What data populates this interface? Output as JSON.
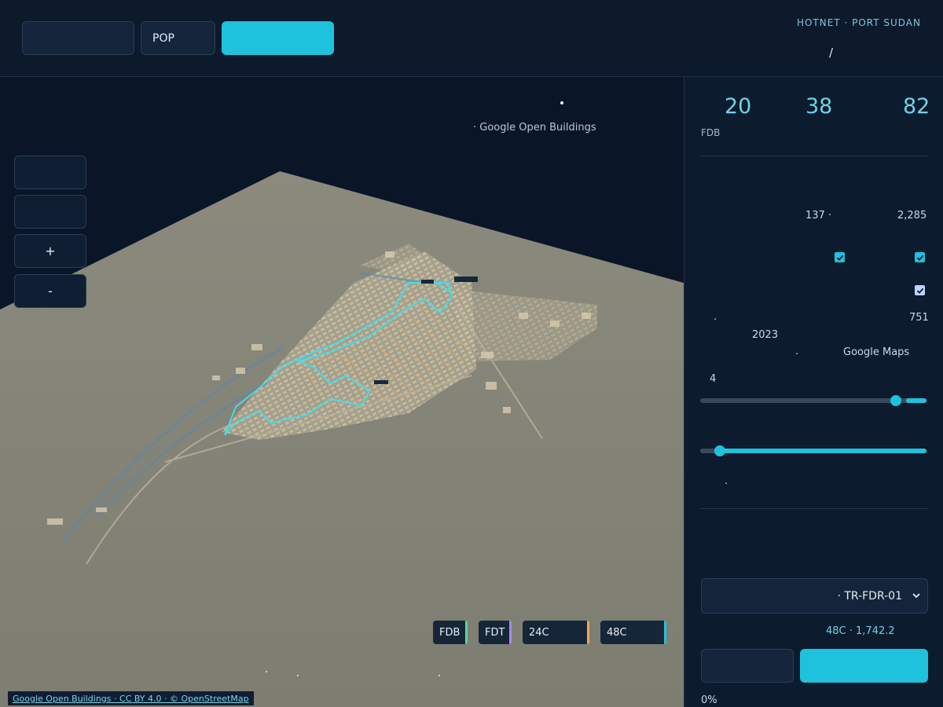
{
  "header": {
    "btn_left": "",
    "btn_pop": "POP",
    "btn_primary": "",
    "brand": "HOTNET · PORT SUDAN",
    "brand_sub": "/"
  },
  "map": {
    "source_note": "· Google Open Buildings",
    "controls": {
      "zoom_in": "+",
      "zoom_out": "-"
    },
    "chips": [
      {
        "label": "FDB",
        "color": "#5ed39a"
      },
      {
        "label": "FDT",
        "color": "#a98be8"
      },
      {
        "label": "24C",
        "color": "#f2a65a"
      },
      {
        "label": "48C",
        "color": "#1fc2dc"
      }
    ],
    "attribution_a": "Google Open Buildings · CC BY 4.0",
    "attribution_sep": " · ",
    "attribution_b": "© OpenStreetMap"
  },
  "panel": {
    "stats": [
      {
        "value": "20"
      },
      {
        "value": "38"
      },
      {
        "value": "82"
      }
    ],
    "stat_label": "FDB",
    "row1_a": "137 ·",
    "row1_b": "2,285",
    "checkboxes": [
      {
        "checked": true
      },
      {
        "checked": true
      },
      {
        "checked": true
      }
    ],
    "row3_dot": ".",
    "row3_val": "751",
    "row4_year": "2023",
    "row5_dot": ".",
    "row5_src": "Google Maps",
    "slider1_label": "4",
    "slider1_value": 0.9,
    "slider2_value": 0.08,
    "slider2_note": ".",
    "feeder_select": "· TR-FDR-01",
    "feeder_info": "48C · 1,742.2",
    "progress": "0%"
  }
}
